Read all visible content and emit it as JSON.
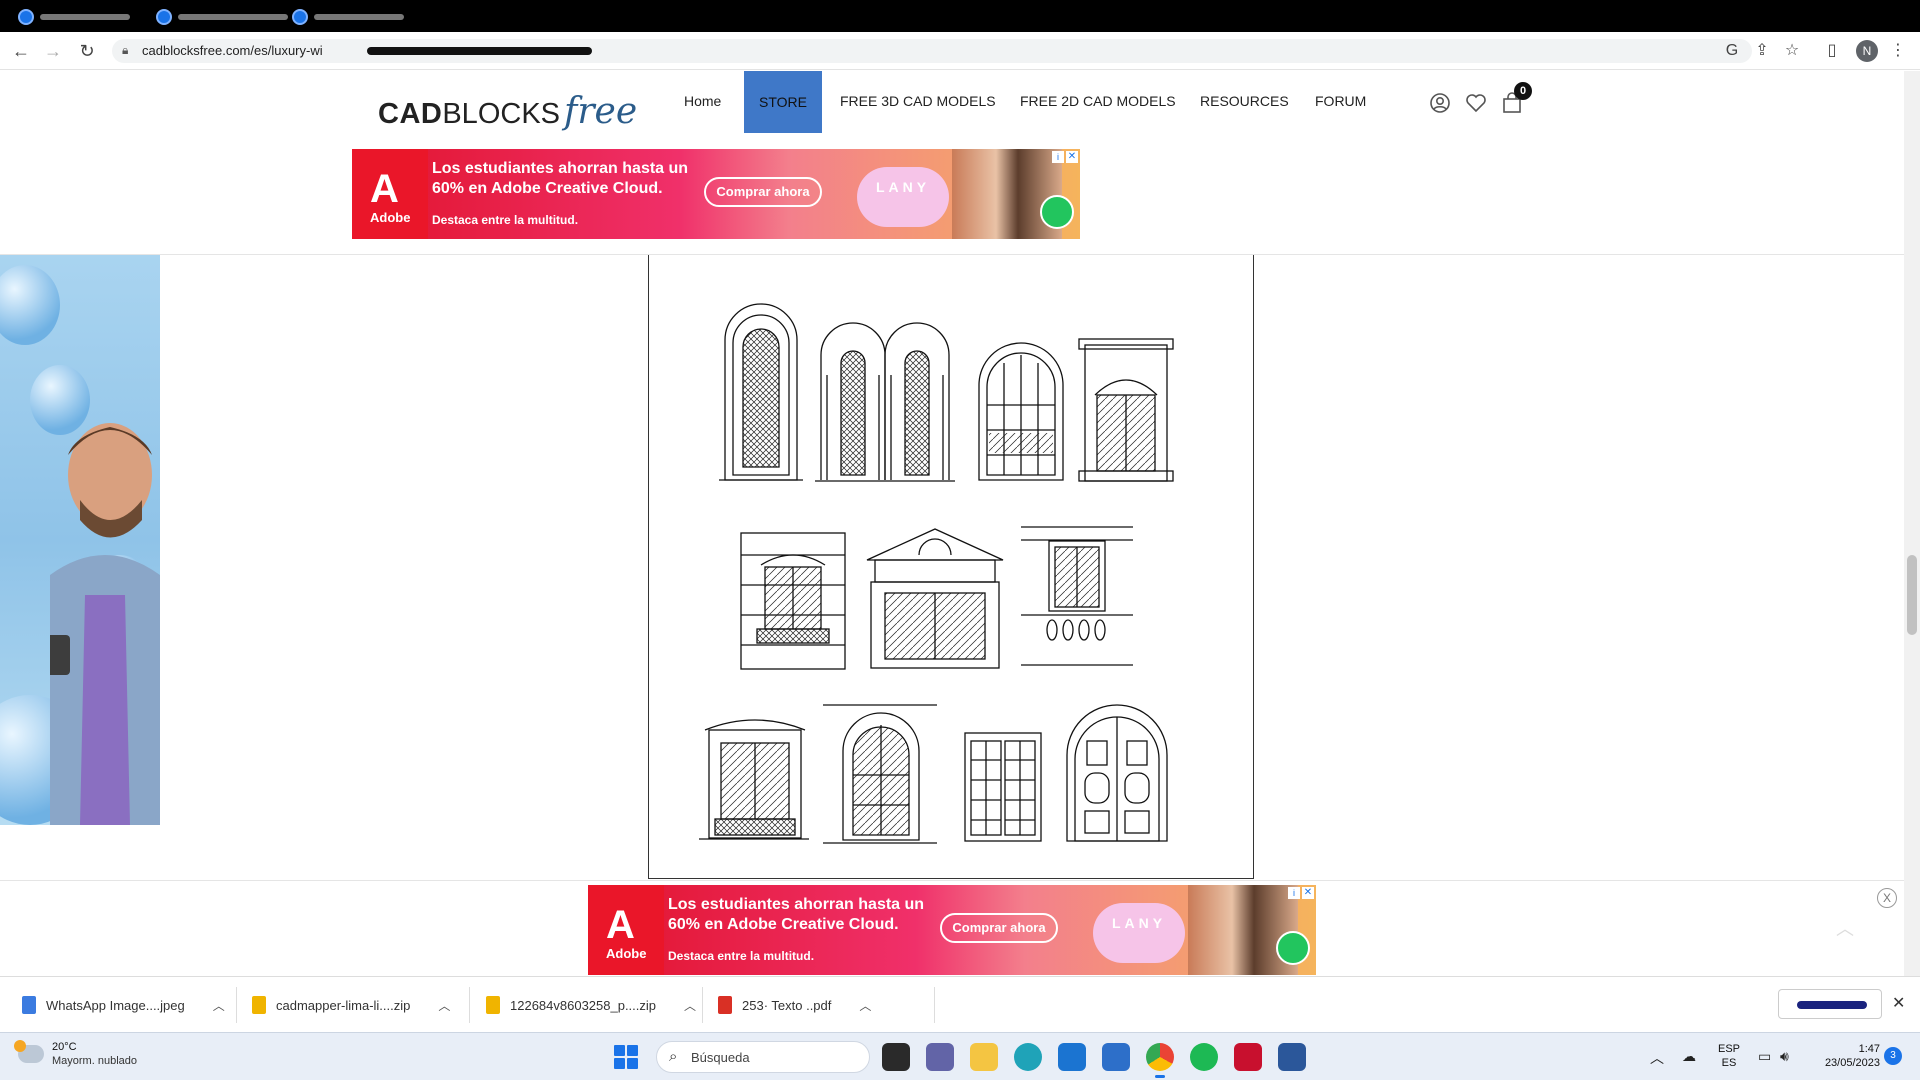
{
  "browser": {
    "url": "cadblocksfree.com/es/luxury-wi",
    "profile_initial": "N"
  },
  "site": {
    "logo": {
      "part1": "CAD",
      "part2": "BLOCKS",
      "part3": "free"
    },
    "nav": {
      "home": "Home",
      "store": "STORE",
      "free3d": "FREE 3D CAD MODELS",
      "free2d": "FREE 2D CAD MODELS",
      "resources": "RESOURCES",
      "forum": "FORUM"
    },
    "cart_count": "0"
  },
  "ad": {
    "brand": "Adobe",
    "headline": "Los estudiantes ahorran hasta un 60% en Adobe Creative Cloud.",
    "tagline": "Destaca entre la multitud.",
    "cta": "Comprar ahora",
    "lany": "LANY",
    "close": "✕",
    "info": "i"
  },
  "bottom_close": "X",
  "downloads": [
    {
      "name": "WhatsApp Image....jpeg",
      "color": "#3b7be0"
    },
    {
      "name": "cadmapper-lima-li....zip",
      "color": "#f0b400"
    },
    {
      "name": "122684v8603258_p....zip",
      "color": "#f0b400"
    },
    {
      "name": "253· Texto ..pdf",
      "color": "#d93025"
    }
  ],
  "taskbar": {
    "temp": "20°C",
    "condition": "Mayorm. nublado",
    "search_placeholder": "Búsqueda",
    "lang1": "ESP",
    "lang2": "ES",
    "time": "1:47",
    "date": "23/05/2023",
    "notifications": "3"
  },
  "colors": {
    "store_accent": "#3f78c8",
    "logo_free": "#2b5c8a",
    "ad_red": "#ea1629"
  }
}
